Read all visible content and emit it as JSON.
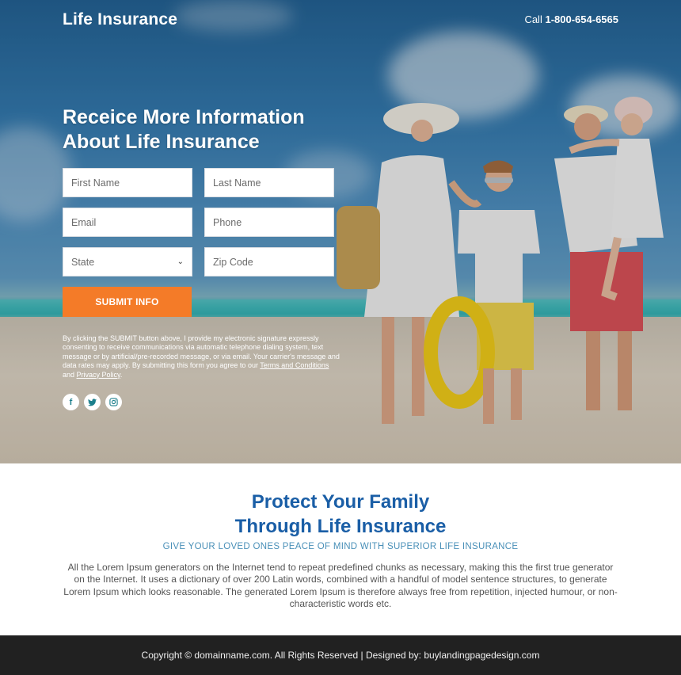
{
  "header": {
    "logo": "Life Insurance",
    "call_prefix": "Call",
    "phone": "1-800-654-6565"
  },
  "hero": {
    "title": "Receice More Information About Life Insurance",
    "form": {
      "first_name_placeholder": "First Name",
      "last_name_placeholder": "Last Name",
      "email_placeholder": "Email",
      "phone_placeholder": "Phone",
      "state_selected": "State",
      "zip_placeholder": "Zip Code",
      "submit_label": "SUBMIT INFO"
    },
    "disclaimer": {
      "text": "By clicking the SUBMIT button above, I provide my electronic signature expressly consenting to receive communications via automatic telephone dialing system, text message or by artificial/pre-recorded message, or via email. Your carrier's message and data rates may apply. By submitting this form you agree to our",
      "terms_link": "Terms and Conditions",
      "and": "and",
      "privacy_link": "Privacy Policy",
      "end": "."
    },
    "social": [
      {
        "icon": "facebook-icon",
        "glyph": "f"
      },
      {
        "icon": "twitter-icon",
        "glyph": "🐦"
      },
      {
        "icon": "instagram-icon",
        "glyph": "◎"
      }
    ]
  },
  "info": {
    "title_line1": "Protect Your Family",
    "title_line2": "Through Life Insurance",
    "subtitle": "GIVE YOUR LOVED ONES PEACE OF MIND WITH SUPERIOR LIFE INSURANCE",
    "body": "All the Lorem Ipsum generators on the Internet tend to repeat predefined chunks as necessary, making this the first true generator on the Internet. It uses a dictionary of over 200 Latin words, combined with a handful of model sentence structures, to generate Lorem Ipsum which looks reasonable. The generated Lorem Ipsum is therefore always free from repetition, injected humour, or non-characteristic words etc."
  },
  "footer": {
    "text": "Copyright © domainname.com. All Rights Reserved | Designed by: buylandingpagedesign.com"
  },
  "colors": {
    "accent_orange": "#f47b28",
    "heading_blue": "#1a5ea6",
    "subtitle_blue": "#4a90b8",
    "footer_bg": "#212121"
  }
}
